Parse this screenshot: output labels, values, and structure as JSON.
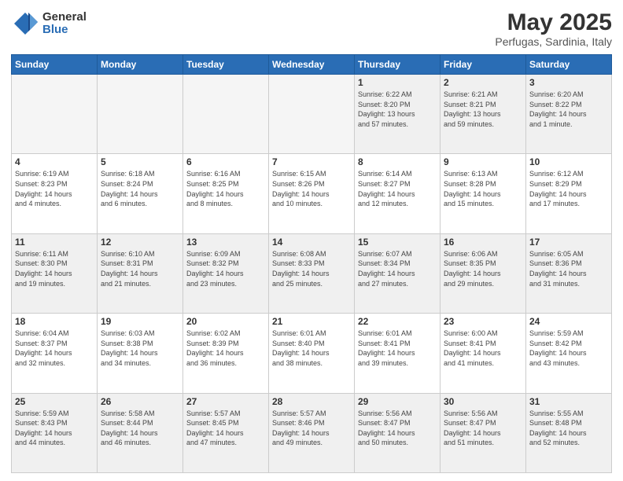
{
  "logo": {
    "general": "General",
    "blue": "Blue"
  },
  "title": "May 2025",
  "subtitle": "Perfugas, Sardinia, Italy",
  "headers": [
    "Sunday",
    "Monday",
    "Tuesday",
    "Wednesday",
    "Thursday",
    "Friday",
    "Saturday"
  ],
  "weeks": [
    [
      {
        "day": "",
        "info": "",
        "empty": true
      },
      {
        "day": "",
        "info": "",
        "empty": true
      },
      {
        "day": "",
        "info": "",
        "empty": true
      },
      {
        "day": "",
        "info": "",
        "empty": true
      },
      {
        "day": "1",
        "info": "Sunrise: 6:22 AM\nSunset: 8:20 PM\nDaylight: 13 hours\nand 57 minutes.",
        "empty": false
      },
      {
        "day": "2",
        "info": "Sunrise: 6:21 AM\nSunset: 8:21 PM\nDaylight: 13 hours\nand 59 minutes.",
        "empty": false
      },
      {
        "day": "3",
        "info": "Sunrise: 6:20 AM\nSunset: 8:22 PM\nDaylight: 14 hours\nand 1 minute.",
        "empty": false
      }
    ],
    [
      {
        "day": "4",
        "info": "Sunrise: 6:19 AM\nSunset: 8:23 PM\nDaylight: 14 hours\nand 4 minutes.",
        "empty": false
      },
      {
        "day": "5",
        "info": "Sunrise: 6:18 AM\nSunset: 8:24 PM\nDaylight: 14 hours\nand 6 minutes.",
        "empty": false
      },
      {
        "day": "6",
        "info": "Sunrise: 6:16 AM\nSunset: 8:25 PM\nDaylight: 14 hours\nand 8 minutes.",
        "empty": false
      },
      {
        "day": "7",
        "info": "Sunrise: 6:15 AM\nSunset: 8:26 PM\nDaylight: 14 hours\nand 10 minutes.",
        "empty": false
      },
      {
        "day": "8",
        "info": "Sunrise: 6:14 AM\nSunset: 8:27 PM\nDaylight: 14 hours\nand 12 minutes.",
        "empty": false
      },
      {
        "day": "9",
        "info": "Sunrise: 6:13 AM\nSunset: 8:28 PM\nDaylight: 14 hours\nand 15 minutes.",
        "empty": false
      },
      {
        "day": "10",
        "info": "Sunrise: 6:12 AM\nSunset: 8:29 PM\nDaylight: 14 hours\nand 17 minutes.",
        "empty": false
      }
    ],
    [
      {
        "day": "11",
        "info": "Sunrise: 6:11 AM\nSunset: 8:30 PM\nDaylight: 14 hours\nand 19 minutes.",
        "empty": false
      },
      {
        "day": "12",
        "info": "Sunrise: 6:10 AM\nSunset: 8:31 PM\nDaylight: 14 hours\nand 21 minutes.",
        "empty": false
      },
      {
        "day": "13",
        "info": "Sunrise: 6:09 AM\nSunset: 8:32 PM\nDaylight: 14 hours\nand 23 minutes.",
        "empty": false
      },
      {
        "day": "14",
        "info": "Sunrise: 6:08 AM\nSunset: 8:33 PM\nDaylight: 14 hours\nand 25 minutes.",
        "empty": false
      },
      {
        "day": "15",
        "info": "Sunrise: 6:07 AM\nSunset: 8:34 PM\nDaylight: 14 hours\nand 27 minutes.",
        "empty": false
      },
      {
        "day": "16",
        "info": "Sunrise: 6:06 AM\nSunset: 8:35 PM\nDaylight: 14 hours\nand 29 minutes.",
        "empty": false
      },
      {
        "day": "17",
        "info": "Sunrise: 6:05 AM\nSunset: 8:36 PM\nDaylight: 14 hours\nand 31 minutes.",
        "empty": false
      }
    ],
    [
      {
        "day": "18",
        "info": "Sunrise: 6:04 AM\nSunset: 8:37 PM\nDaylight: 14 hours\nand 32 minutes.",
        "empty": false
      },
      {
        "day": "19",
        "info": "Sunrise: 6:03 AM\nSunset: 8:38 PM\nDaylight: 14 hours\nand 34 minutes.",
        "empty": false
      },
      {
        "day": "20",
        "info": "Sunrise: 6:02 AM\nSunset: 8:39 PM\nDaylight: 14 hours\nand 36 minutes.",
        "empty": false
      },
      {
        "day": "21",
        "info": "Sunrise: 6:01 AM\nSunset: 8:40 PM\nDaylight: 14 hours\nand 38 minutes.",
        "empty": false
      },
      {
        "day": "22",
        "info": "Sunrise: 6:01 AM\nSunset: 8:41 PM\nDaylight: 14 hours\nand 39 minutes.",
        "empty": false
      },
      {
        "day": "23",
        "info": "Sunrise: 6:00 AM\nSunset: 8:41 PM\nDaylight: 14 hours\nand 41 minutes.",
        "empty": false
      },
      {
        "day": "24",
        "info": "Sunrise: 5:59 AM\nSunset: 8:42 PM\nDaylight: 14 hours\nand 43 minutes.",
        "empty": false
      }
    ],
    [
      {
        "day": "25",
        "info": "Sunrise: 5:59 AM\nSunset: 8:43 PM\nDaylight: 14 hours\nand 44 minutes.",
        "empty": false
      },
      {
        "day": "26",
        "info": "Sunrise: 5:58 AM\nSunset: 8:44 PM\nDaylight: 14 hours\nand 46 minutes.",
        "empty": false
      },
      {
        "day": "27",
        "info": "Sunrise: 5:57 AM\nSunset: 8:45 PM\nDaylight: 14 hours\nand 47 minutes.",
        "empty": false
      },
      {
        "day": "28",
        "info": "Sunrise: 5:57 AM\nSunset: 8:46 PM\nDaylight: 14 hours\nand 49 minutes.",
        "empty": false
      },
      {
        "day": "29",
        "info": "Sunrise: 5:56 AM\nSunset: 8:47 PM\nDaylight: 14 hours\nand 50 minutes.",
        "empty": false
      },
      {
        "day": "30",
        "info": "Sunrise: 5:56 AM\nSunset: 8:47 PM\nDaylight: 14 hours\nand 51 minutes.",
        "empty": false
      },
      {
        "day": "31",
        "info": "Sunrise: 5:55 AM\nSunset: 8:48 PM\nDaylight: 14 hours\nand 52 minutes.",
        "empty": false
      }
    ]
  ]
}
